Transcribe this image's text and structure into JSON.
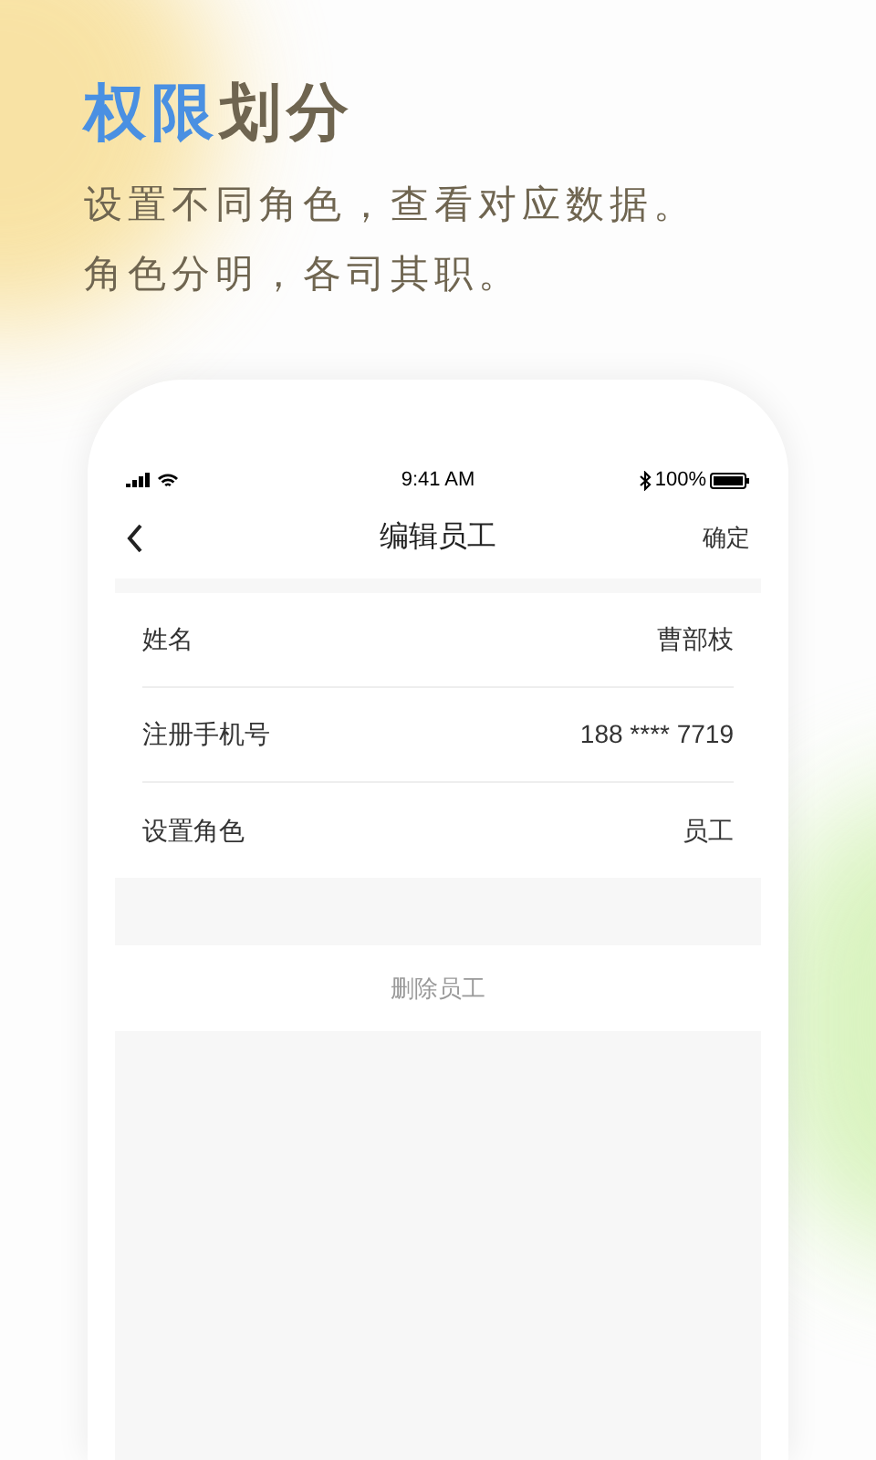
{
  "headline": {
    "highlight": "权限",
    "rest": "划分"
  },
  "subtitle_lines": [
    "设置不同角色，查看对应数据。",
    "角色分明，各司其职。"
  ],
  "status_bar": {
    "time": "9:41 AM",
    "battery": "100%"
  },
  "nav": {
    "title": "编辑员工",
    "action": "确定"
  },
  "fields": [
    {
      "label": "姓名",
      "value": "曹部枝"
    },
    {
      "label": "注册手机号",
      "value": "188 **** 7719"
    },
    {
      "label": "设置角色",
      "value": "员工"
    }
  ],
  "delete_button": "删除员工"
}
